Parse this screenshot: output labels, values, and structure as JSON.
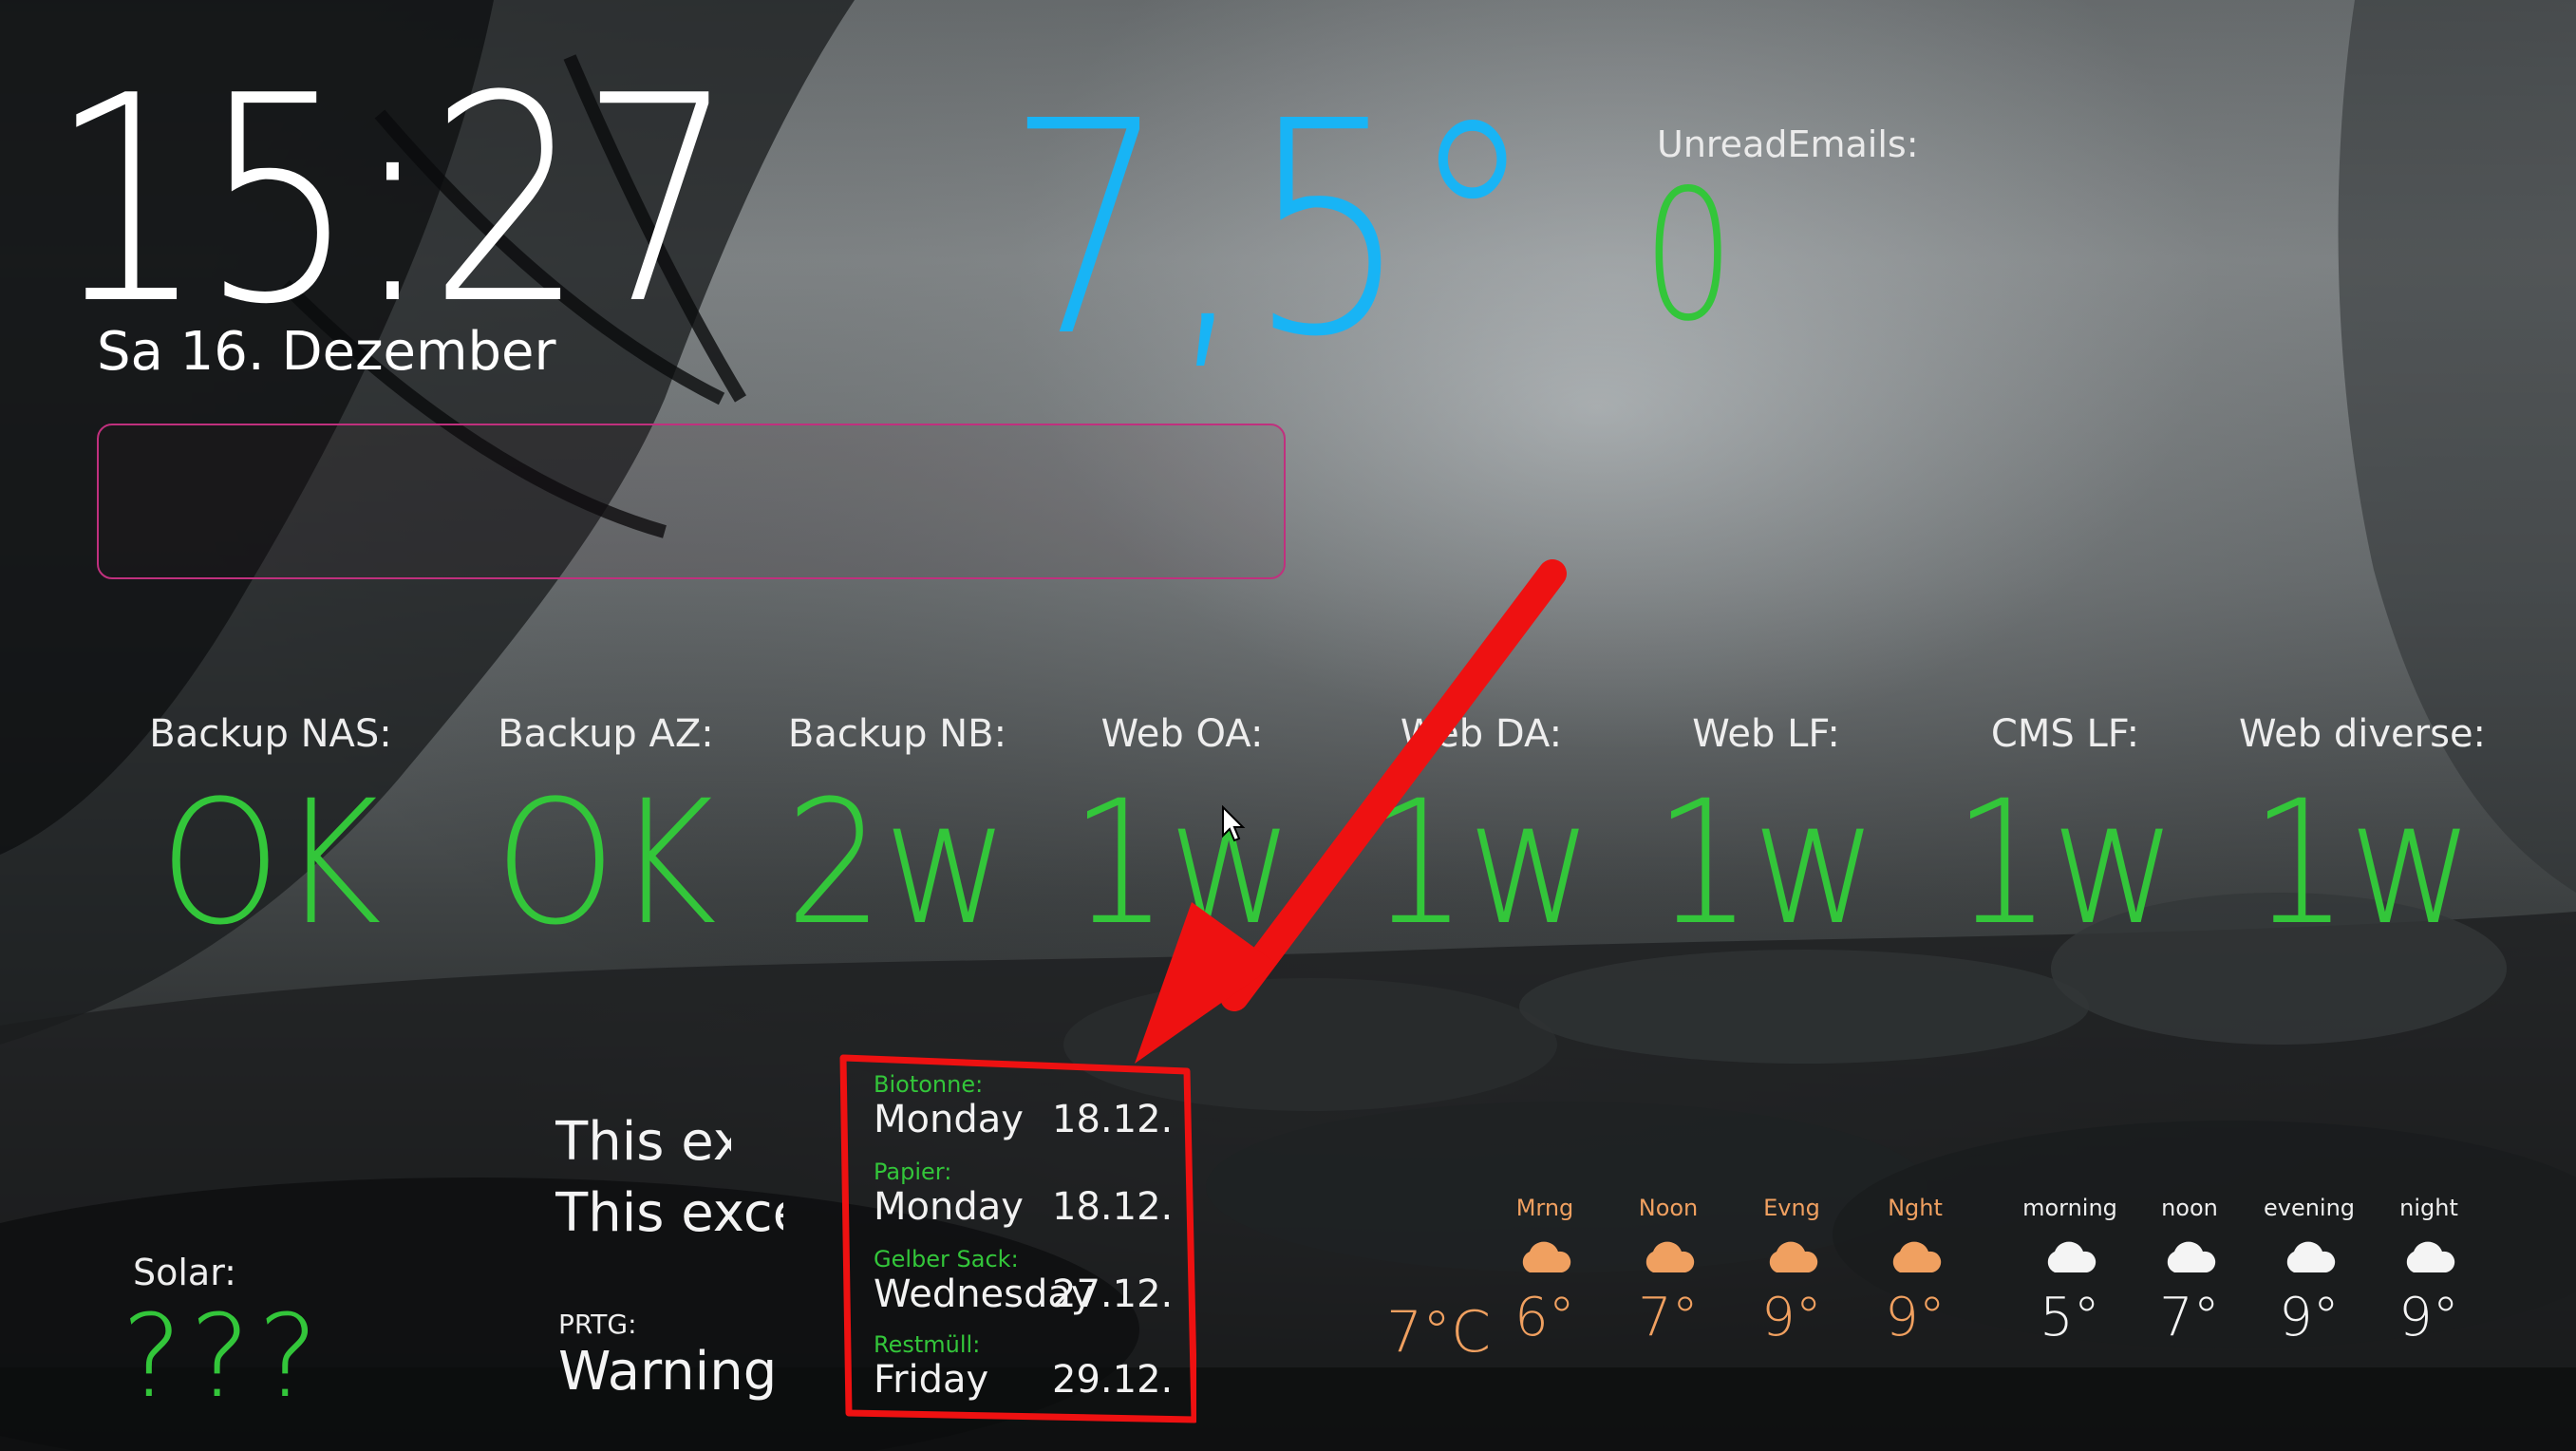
{
  "clock": {
    "time": "15:27",
    "date": "Sa 16. Dezember"
  },
  "weather_now": {
    "temperature": "7,5°"
  },
  "email": {
    "label": "UnreadEmails:",
    "count": "0"
  },
  "message_box": {
    "text": ""
  },
  "status_tiles": [
    {
      "label": "Backup NAS:",
      "value": "OK"
    },
    {
      "label": "Backup AZ:",
      "value": "OK"
    },
    {
      "label": "Backup NB:",
      "value": "2w"
    },
    {
      "label": "Web OA:",
      "value": "1w"
    },
    {
      "label": "Web DA:",
      "value": "1w"
    },
    {
      "label": "Web LF:",
      "value": "1w"
    },
    {
      "label": "CMS LF:",
      "value": "1w"
    },
    {
      "label": "Web diverse:",
      "value": "1w"
    }
  ],
  "solar": {
    "label": "Solar:",
    "value": "???"
  },
  "excel_messages": [
    "This exc",
    "This excel"
  ],
  "prtg": {
    "label": "PRTG:",
    "value": "Warning"
  },
  "trash": [
    {
      "label": "Biotonne:",
      "day": "Monday",
      "date": "18.12."
    },
    {
      "label": "Papier:",
      "day": "Monday",
      "date": "18.12."
    },
    {
      "label": "Gelber Sack:",
      "day": "Wednesday",
      "date": "27.12."
    },
    {
      "label": "Restmüll:",
      "day": "Friday",
      "date": "29.12."
    }
  ],
  "forecast_current": "7°C",
  "forecast_today": [
    {
      "period": "Mrng",
      "temp": "6°"
    },
    {
      "period": "Noon",
      "temp": "7°"
    },
    {
      "period": "Evng",
      "temp": "9°"
    },
    {
      "period": "Nght",
      "temp": "9°"
    }
  ],
  "forecast_tomorrow": [
    {
      "period": "morning",
      "temp": "5°"
    },
    {
      "period": "noon",
      "temp": "7°"
    },
    {
      "period": "evening",
      "temp": "9°"
    },
    {
      "period": "night",
      "temp": "9°"
    }
  ],
  "colors": {
    "accent_green": "#33c63a",
    "accent_blue": "#18b4f5",
    "accent_orange": "#f0a060",
    "message_border": "#c0307e",
    "annotation_red": "#ee1111"
  },
  "icons": {
    "forecast_today": "cloud-icon-orange",
    "forecast_tomorrow": "cloud-icon-white",
    "pointer": "mouse-cursor-icon",
    "annotation": "red-arrow-annotation"
  }
}
